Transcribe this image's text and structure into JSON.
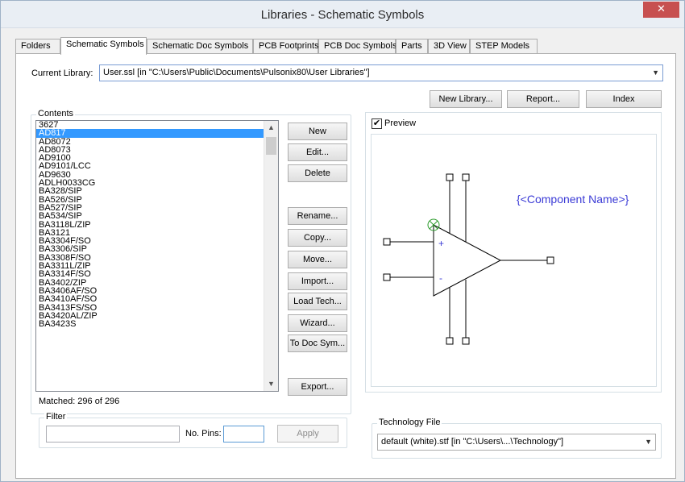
{
  "window": {
    "title": "Libraries - Schematic Symbols",
    "close_glyph": "✕"
  },
  "tabs": [
    {
      "label": "Folders"
    },
    {
      "label": "Schematic Symbols"
    },
    {
      "label": "Schematic Doc Symbols"
    },
    {
      "label": "PCB Footprints"
    },
    {
      "label": "PCB Doc Symbols"
    },
    {
      "label": "Parts"
    },
    {
      "label": "3D View"
    },
    {
      "label": "STEP Models"
    }
  ],
  "current_library": {
    "label": "Current Library:",
    "value": "User.ssl   [in \"C:\\Users\\Public\\Documents\\Pulsonix80\\User Libraries\"]"
  },
  "top_buttons": {
    "new_library": "New Library...",
    "report": "Report...",
    "index": "Index"
  },
  "contents": {
    "title": "Contents",
    "items": [
      "3627",
      "AD817",
      "AD8072",
      "AD8073",
      "AD9100",
      "AD9101/LCC",
      "AD9630",
      "ADLH0033CG",
      "BA328/SIP",
      "BA526/SIP",
      "BA527/SIP",
      "BA534/SIP",
      "BA3118L/ZIP",
      "BA3121",
      "BA3304F/SO",
      "BA3306/SIP",
      "BA3308F/SO",
      "BA3311L/ZIP",
      "BA3314F/SO",
      "BA3402/ZIP",
      "BA3406AF/SO",
      "BA3410AF/SO",
      "BA3413FS/SO",
      "BA3420AL/ZIP",
      "BA3423S"
    ],
    "selected": "AD817",
    "matched": "Matched: 296 of 296"
  },
  "side_buttons": {
    "new": "New",
    "edit": "Edit...",
    "delete": "Delete",
    "rename": "Rename...",
    "copy": "Copy...",
    "move": "Move...",
    "import": "Import...",
    "load_tech": "Load Tech...",
    "wizard": "Wizard...",
    "to_doc_sym": "To Doc Sym...",
    "export": "Export..."
  },
  "filter": {
    "title": "Filter",
    "no_pins_label": "No. Pins:",
    "apply": "Apply",
    "filter_value": "",
    "no_pins_value": ""
  },
  "preview": {
    "checkbox_label": "Preview",
    "checked": true,
    "component_name": "{<Component Name>}",
    "plus": "+",
    "minus": "-"
  },
  "technology": {
    "title": "Technology File",
    "value": "default (white).stf   [in \"C:\\Users\\...\\Technology\"]"
  },
  "colors": {
    "selection": "#3399ff",
    "component_name": "#3b3bd6",
    "pin_marker": "#2a9a2a"
  }
}
